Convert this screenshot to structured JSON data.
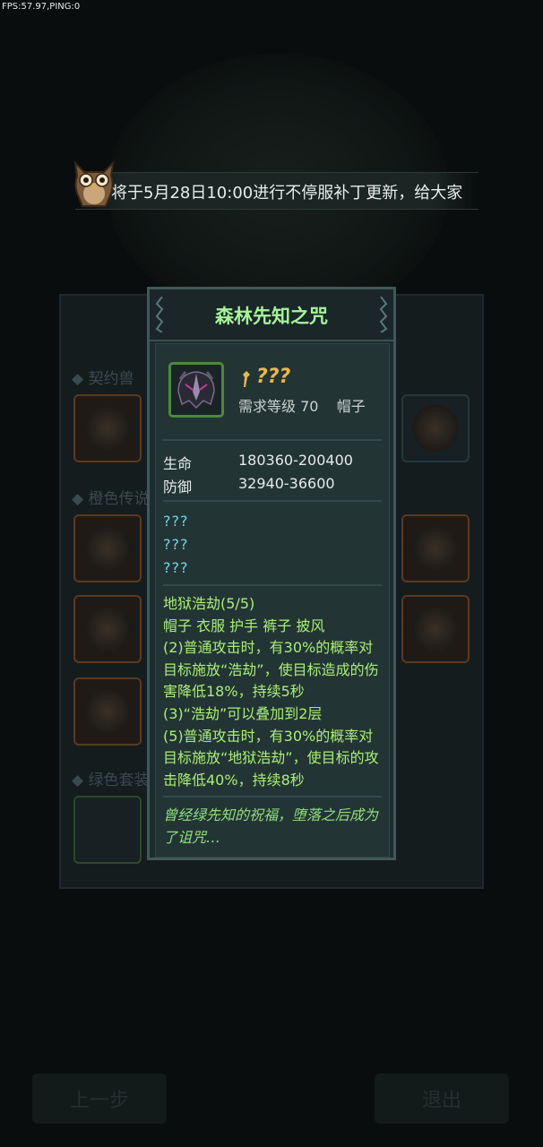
{
  "overlay": {
    "fps_text": "FPS:57.97,PING:0"
  },
  "announcement": {
    "text": "将于5月28日10:00进行不停服补丁更新，给大家"
  },
  "background": {
    "sections": [
      "◆ 契约兽",
      "◆ 橙色传说",
      "◆ 绿色套装"
    ],
    "buttons": {
      "prev": "上一步",
      "exit": "退出"
    }
  },
  "tooltip": {
    "title": "森林先知之咒",
    "unknown_name": "???",
    "requirement": "需求等级 70    帽子",
    "stats": [
      {
        "label": "生命",
        "value": "180360-200400"
      },
      {
        "label": "防御",
        "value": "32940-36600"
      }
    ],
    "unknown_attrs": [
      "???",
      "???",
      "???"
    ],
    "set_bonus": [
      "地狱浩劫(5/5)",
      "帽子 衣服 护手 裤子 披风",
      "(2)普通攻击时，有30%的概率对目标施放“浩劫”，使目标造成的伤害降低18%，持续5秒",
      "(3)“浩劫”可以叠加到2层",
      "(5)普通攻击时，有30%的概率对目标施放“地狱浩劫”，使目标的攻击降低40%，持续8秒"
    ],
    "flavor": "曾经绿先知的祝福，堕落之后成为了诅咒…"
  },
  "colors": {
    "title_green": "#a6f59a",
    "set_green": "#a8ef74",
    "unknown_cyan": "#6fd6e6",
    "qmark_gold": "#e8b84a"
  }
}
